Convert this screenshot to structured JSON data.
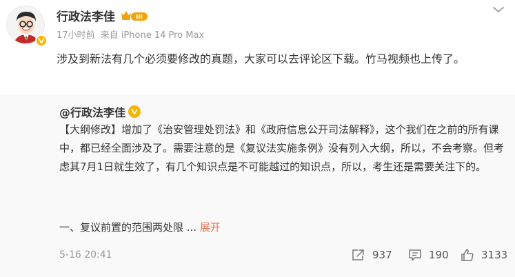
{
  "post": {
    "author": "行政法李佳",
    "member_level": "III",
    "time": "17小时前",
    "source": "来自 iPhone 14 Pro Max",
    "text": "涉及到新法有几个必须要修改的真题，大家可以去评论区下载。竹马视频也上传了。"
  },
  "repost": {
    "author": "@行政法李佳",
    "text": "【大纲修改】增加了《治安管理处罚法》和《政府信息公开司法解释》，这个我们在之前的所有课中，都已经全面涉及了。需要注意的是《复议法实施条例》没有列入大纲，所以，不会考察。但考虑其7月1日就生效了，有几个知识点是不可能越过的知识点，所以，考生还是需要关注下的。",
    "outline_item": "一、复议前置的范围两处限 ...",
    "expand_label": "展开",
    "date": "5-16 20:41",
    "reposts": "937",
    "comments": "190",
    "likes": "3133"
  },
  "icons": {
    "avatar": "avatar-cartoon",
    "verified": "orange-v-badge",
    "member": "crown-member-badge",
    "menu": "chevron-down-icon",
    "repost": "share-icon",
    "comment": "comment-icon",
    "like": "thumbs-up-icon"
  },
  "colors": {
    "link": "#eb7350",
    "verified": "#f7b500",
    "repost_bg": "#f9f9f9",
    "meta": "#999999"
  }
}
